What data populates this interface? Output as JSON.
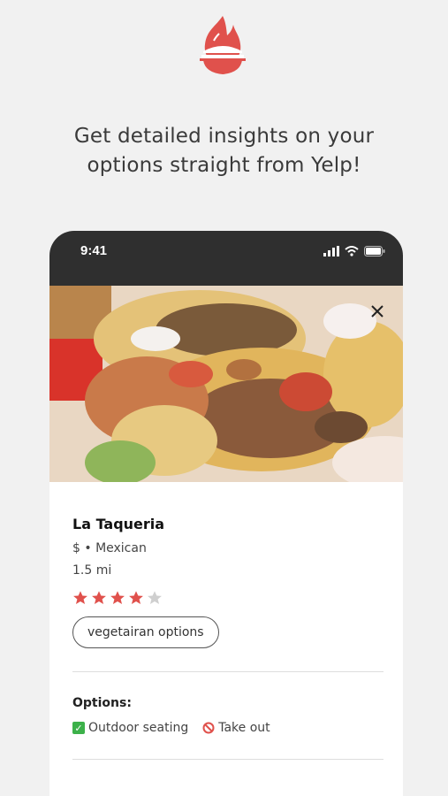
{
  "headline": {
    "line1": "Get detailed insights on your",
    "line2": "options straight from Yelp!"
  },
  "status_bar": {
    "time": "9:41"
  },
  "restaurant": {
    "name": "La Taqueria",
    "price_cuisine": "$ • Mexican",
    "distance": "1.5 mi",
    "rating": 4,
    "max_rating": 5,
    "tag": "vegetairan options"
  },
  "options": {
    "title": "Options:",
    "items": [
      {
        "label": "Outdoor seating",
        "available": true
      },
      {
        "label": "Take out",
        "available": false
      }
    ]
  },
  "colors": {
    "brand": "#e0514c",
    "star_filled": "#e0514c",
    "star_empty": "#cfcfcf",
    "status_bar": "#2f2f2f",
    "background": "#f1f1f1"
  },
  "icons": [
    "flame-burger-logo-icon",
    "signal-icon",
    "wifi-icon",
    "battery-icon",
    "close-icon",
    "star-icon",
    "check-icon",
    "prohibited-icon"
  ]
}
